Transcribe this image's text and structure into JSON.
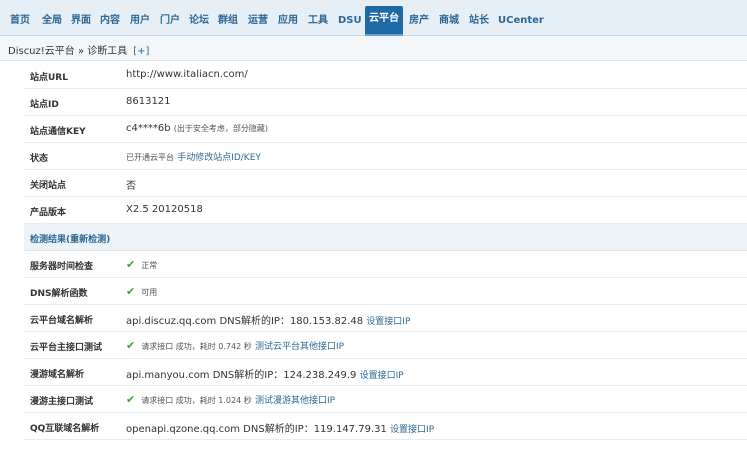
{
  "nav": {
    "items": [
      "首页",
      "全局",
      "界面",
      "内容",
      "用户",
      "门户",
      "论坛",
      "群组",
      "运营",
      "应用",
      "工具",
      "DSU",
      "云平台",
      "房产",
      "商城",
      "站长",
      "UCenter"
    ],
    "active": "云平台"
  },
  "breadcrumb": {
    "text": "Discuz!云平台 » 诊断工具",
    "add": "[+]"
  },
  "site_info": {
    "url_label": "站点URL",
    "url_value": "http://www.italiacn.com/",
    "id_label": "站点ID",
    "id_value": "8613121",
    "key_label": "站点通信KEY",
    "key_value": "c4****6b",
    "key_note": "(出于安全考虑，部分隐藏)",
    "status_label": "状态",
    "status_value": "已开通云平台",
    "status_link": "手动修改站点ID/KEY",
    "closed_label": "关闭站点",
    "closed_value": "否",
    "version_label": "产品版本",
    "version_value": "X2.5 20120518"
  },
  "checks": {
    "title": "检测结果(",
    "redo": "重新检测",
    "title_end": ")",
    "server_time_label": "服务器时间检查",
    "server_time_value": "正常",
    "dns_func_label": "DNS解析函数",
    "dns_func_value": "可用",
    "cloud_dns_label": "云平台域名解析",
    "cloud_dns_value": "api.discuz.qq.com DNS解析的IP：180.153.82.48",
    "cloud_dns_link": "设置接口IP",
    "cloud_api_label": "云平台主接口测试",
    "cloud_api_value": "请求接口 成功，耗时 0.742 秒",
    "cloud_api_link": "测试云平台其他接口IP",
    "manyou_dns_label": "漫游域名解析",
    "manyou_dns_value": "api.manyou.com DNS解析的IP：124.238.249.9",
    "manyou_dns_link": "设置接口IP",
    "manyou_api_label": "漫游主接口测试",
    "manyou_api_value": "请求接口 成功，耗时 1.024 秒",
    "manyou_api_link": "测试漫游其他接口IP",
    "qq_dns_label": "QQ互联域名解析",
    "qq_dns_value": "openapi.qzone.qq.com DNS解析的IP：119.147.79.31",
    "qq_dns_link": "设置接口IP"
  },
  "colors": {
    "accent": "#1e6aa6",
    "link": "#2e6996",
    "ok": "#3aa838"
  }
}
